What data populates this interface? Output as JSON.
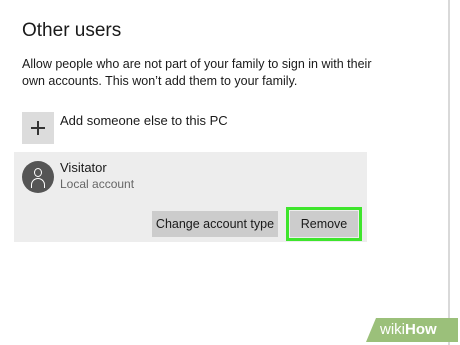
{
  "section": {
    "title": "Other users",
    "description": "Allow people who are not part of your family to sign in with their own accounts. This won’t add them to your family."
  },
  "add_user": {
    "label": "Add someone else to this PC",
    "icon": "plus-icon"
  },
  "user": {
    "name": "Visitator",
    "type": "Local account",
    "icon": "person-icon"
  },
  "buttons": {
    "change_account_type": "Change account type",
    "remove": "Remove"
  },
  "highlight_color": "#3ee52c",
  "watermark": {
    "light": "wiki",
    "bold": "How"
  }
}
